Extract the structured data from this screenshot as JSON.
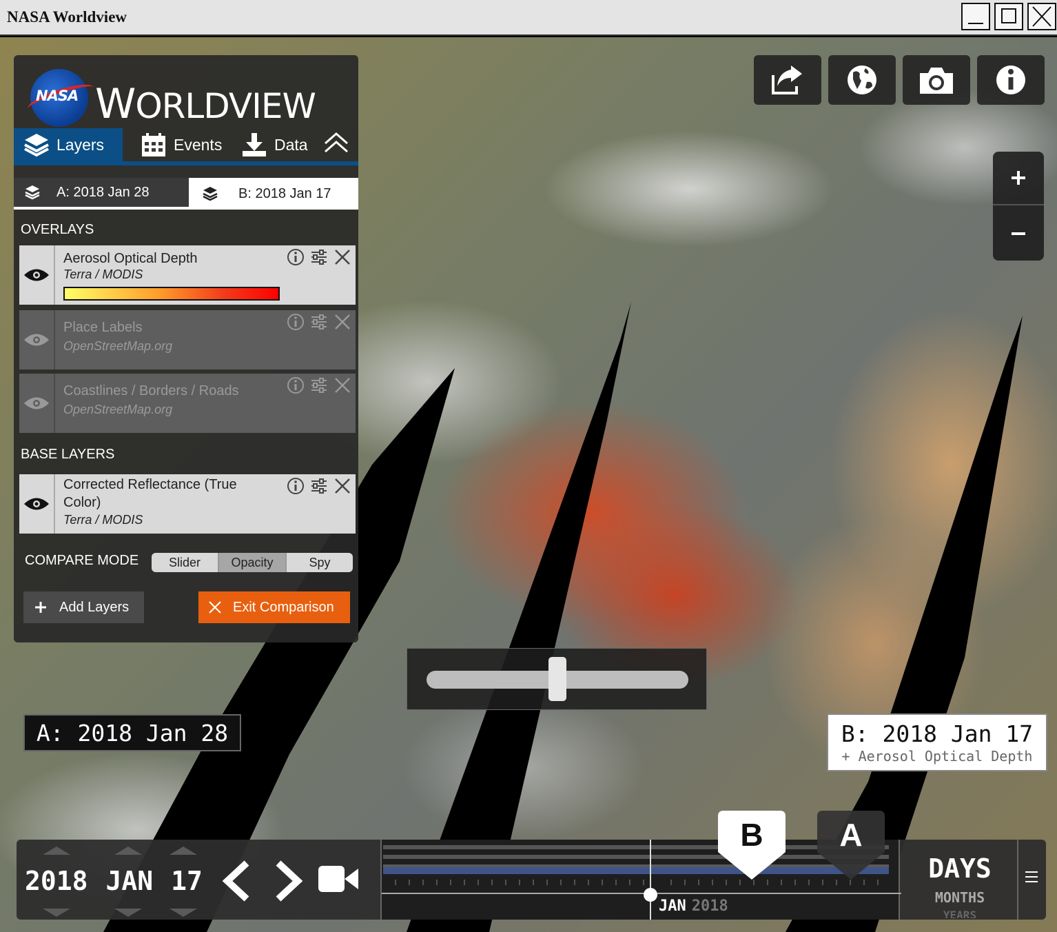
{
  "window": {
    "title": "NASA Worldview"
  },
  "logo": {
    "nasa": "NASA",
    "wordmark_first": "W",
    "wordmark_rest": "ORLDVIEW"
  },
  "tabs": {
    "layers": "Layers",
    "events": "Events",
    "data": "Data"
  },
  "compare_tabs": {
    "a": "A: 2018 Jan 28",
    "b": "B: 2018 Jan 17"
  },
  "overlays": {
    "heading": "OVERLAYS",
    "items": [
      {
        "name": "Aerosol Optical Depth",
        "source": "Terra / MODIS",
        "visible": true
      },
      {
        "name": "Place Labels",
        "source": "OpenStreetMap.org",
        "visible": false
      },
      {
        "name": "Coastlines / Borders / Roads",
        "source": "OpenStreetMap.org",
        "visible": false
      }
    ]
  },
  "base_layers": {
    "heading": "BASE LAYERS",
    "items": [
      {
        "name": "Corrected Reflectance (True Color)",
        "source": "Terra / MODIS",
        "visible": true
      }
    ]
  },
  "compare_mode": {
    "label": "COMPARE MODE",
    "options": [
      "Slider",
      "Opacity",
      "Spy"
    ],
    "selected": "Opacity"
  },
  "buttons": {
    "add_layers": "Add Layers",
    "exit_comparison": "Exit Comparison"
  },
  "opacity_slider": {
    "value": 0.5
  },
  "map_labels": {
    "a": "A: 2018 Jan 28",
    "b": "B: 2018 Jan 17",
    "b_sub": "+ Aerosol Optical Depth"
  },
  "timeline": {
    "year": "2018",
    "month": "JAN",
    "day": "17",
    "axis_month": "JAN",
    "axis_year": "2018",
    "zoom_current": "DAYS",
    "zoom_next": "MONTHS",
    "zoom_next2": "YEARS",
    "marker_a": "A",
    "marker_b": "B"
  },
  "toolbar_icons": [
    "share-icon",
    "globe-icon",
    "camera-icon",
    "info-icon"
  ],
  "colors": {
    "accent_blue": "#0b4f86",
    "exit_orange": "#e8600f",
    "aod_colormap": [
      "#ffff66",
      "#ff9a2a",
      "#f23a1a",
      "#ff0000"
    ]
  }
}
